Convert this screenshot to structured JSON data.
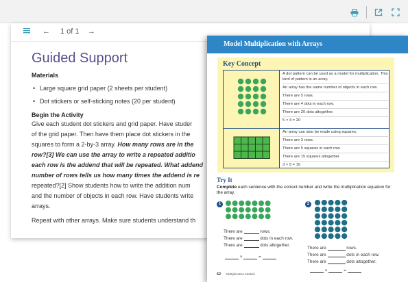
{
  "topbar": {
    "icons": [
      "printer-icon",
      "external-link-icon",
      "expand-icon"
    ]
  },
  "viewer": {
    "toolbar": {
      "menu_icon": "hamburger-icon",
      "prev_icon": "arrow-left-icon",
      "page_label": "1 of 1",
      "next_icon": "arrow-right-icon"
    },
    "doc": {
      "title": "Guided Support",
      "materials_heading": "Materials",
      "materials": [
        "Large square grid paper (2 sheets per student)",
        "Dot stickers or self-sticking notes (20 per student)"
      ],
      "activity_heading": "Begin the Activity",
      "activity_lines": [
        "Give each student dot stickers and grid paper. Have studer",
        "of the grid paper. Then have them place dot stickers in the",
        "squares to form a 2-by-3 array.",
        "row?[3]",
        "each row is the addend that will be repeated. What addend",
        "number of rows tells us how many times the addend is re",
        "repeated?[2] Show students how to write the addition num",
        "and the number of objects in each row. Have students write",
        "arrays."
      ],
      "line3_bold": "How many rows are in the",
      "line4_bold": "We can use the array to write a repeated additio",
      "repeat_line": "Repeat with other arrays. Make sure students understand th"
    }
  },
  "page": {
    "header": "Model Multiplication with Arrays",
    "key_concept": {
      "title": "Key Concept",
      "box1": [
        "A dot pattern can be used as a model for multiplication. This kind of pattern is an array.",
        "An array has the same number of objects in each row.",
        "There are 5 rows.",
        "There are 4 dots in each row.",
        "There are 20 dots altogether.",
        "5 × 4 = 20"
      ],
      "box2": [
        "An array can also be made using squares.",
        "There are 3 rows.",
        "There are 5 squares in each row.",
        "There are 15 squares altogether.",
        "3 × 5 = 15"
      ],
      "dot_array": {
        "rows": 5,
        "cols": 4,
        "color": "#3aa65a"
      },
      "square_array": {
        "rows": 3,
        "cols": 5,
        "color": "#4cb84a"
      }
    },
    "try_it": {
      "title": "Try It",
      "instruction_bold": "Complete",
      "instruction_rest": " each sentence with the correct number and write the multiplication equation for the array.",
      "q1": {
        "number": "1",
        "dots": {
          "rows": 3,
          "cols": 7,
          "color": "#3aa65a"
        },
        "lines": [
          "There are",
          "rows.",
          "There are",
          "dots in each row.",
          "There are",
          "dots altogether."
        ],
        "times": "×",
        "equals": "="
      },
      "q2": {
        "number": "2",
        "dots": {
          "rows": 6,
          "cols": 5,
          "color": "#1f6e86"
        },
        "lines": [
          "There are",
          "rows.",
          "There are",
          "dots in each row.",
          "There are",
          "dots altogether."
        ],
        "times": "×",
        "equals": "="
      }
    },
    "footer": {
      "page_number": "62",
      "title": "Multiplication Models"
    }
  }
}
